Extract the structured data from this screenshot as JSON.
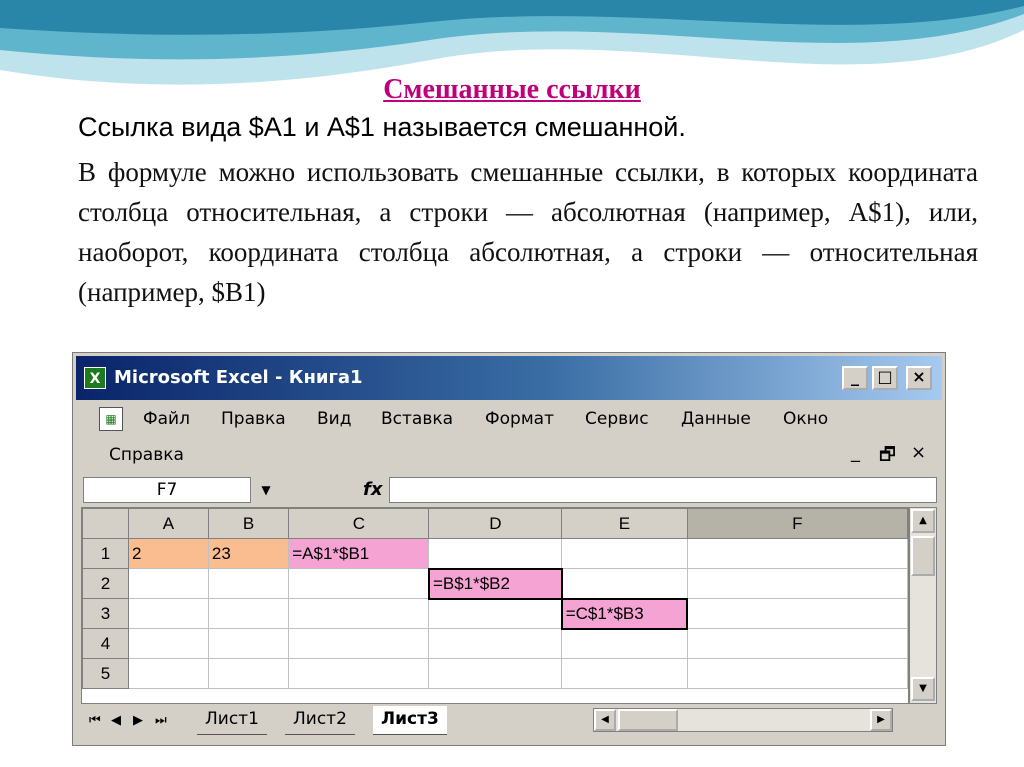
{
  "slide": {
    "title": "Смешанные ссылки",
    "line1": "Ссылка вида $A1 и A$1 называется смешанной.",
    "paragraph": "В формуле можно использовать смешанные ссылки, в которых координата столбца относительная, а строки — абсолютная (например, A$1), или, наоборот, координата столбца абсолютная, а строки — относительная (например, $B1)"
  },
  "window": {
    "title": "Microsoft Excel - Книга1",
    "app_icon": "excel-icon",
    "buttons": {
      "minimize": "_",
      "maximize": "□",
      "close": "×"
    }
  },
  "menu": {
    "items": [
      "Файл",
      "Правка",
      "Вид",
      "Вставка",
      "Формат",
      "Сервис",
      "Данные",
      "Окно"
    ],
    "help": "Справка",
    "mdi": {
      "minimize": "_",
      "restore": "🗗",
      "close": "×"
    }
  },
  "formula_bar": {
    "name_box": "F7",
    "fx": "fx",
    "value": ""
  },
  "sheet": {
    "columns": [
      "A",
      "B",
      "C",
      "D",
      "E",
      "F"
    ],
    "rows": [
      {
        "label": "1",
        "cells": [
          "2",
          "23",
          "=A$1*$B1",
          "",
          "",
          ""
        ]
      },
      {
        "label": "2",
        "cells": [
          "",
          "",
          "",
          "=B$1*$B2",
          "",
          ""
        ]
      },
      {
        "label": "3",
        "cells": [
          "",
          "",
          "",
          "",
          "=C$1*$B3",
          ""
        ]
      },
      {
        "label": "4",
        "cells": [
          "",
          "",
          "",
          "",
          "",
          ""
        ]
      },
      {
        "label": "5",
        "cells": [
          "",
          "",
          "",
          "",
          "",
          ""
        ]
      }
    ],
    "colors": {
      "value_fill": "#f9bd8f",
      "formula_fill": "#f5a3d3",
      "selected_header": "#b5b2a8"
    }
  },
  "tabs": {
    "nav": [
      "⏮",
      "◀",
      "▶",
      "⏭"
    ],
    "sheets": [
      "Лист1",
      "Лист2",
      "Лист3"
    ],
    "active": "Лист3"
  }
}
